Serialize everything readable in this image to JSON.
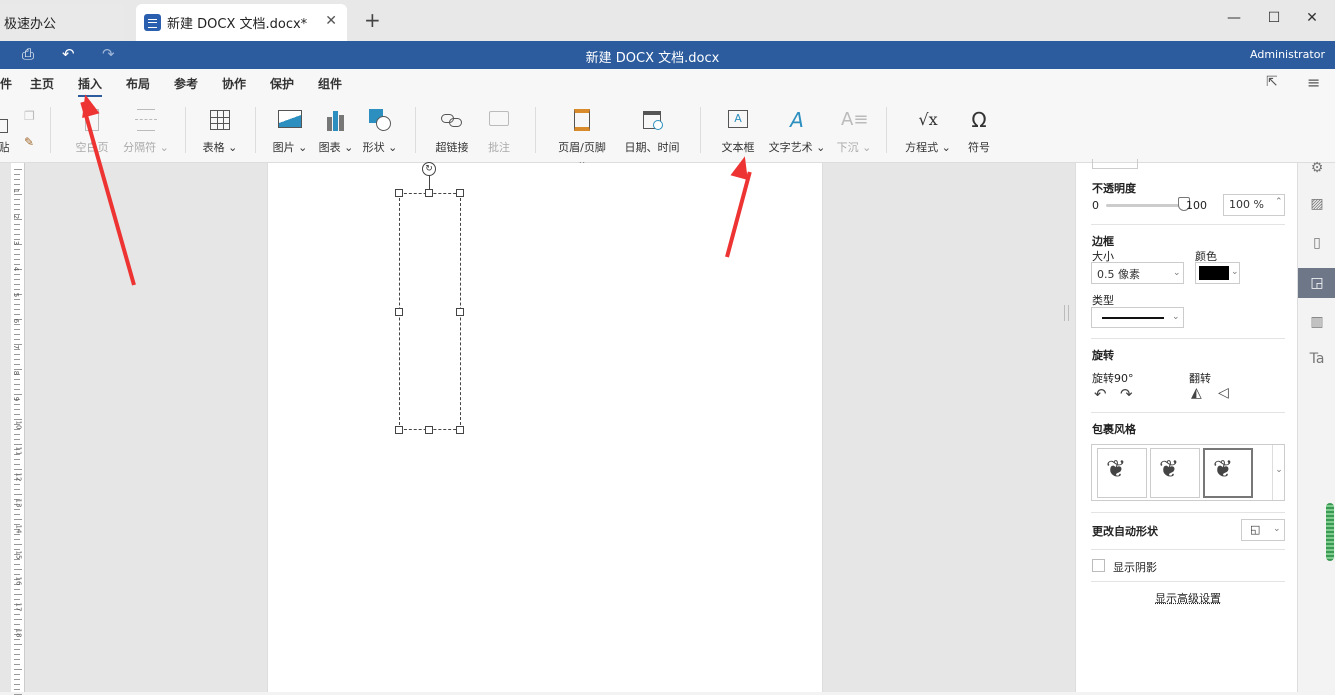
{
  "tabs": {
    "home_tab": "极速办公",
    "doc_tab": "新建 DOCX 文档.docx*",
    "new_tab": "+"
  },
  "window": {
    "minimize": "—",
    "maximize": "☐",
    "close": "✕"
  },
  "titlebar": {
    "title": "新建 DOCX 文档.docx",
    "user": "Administrator"
  },
  "menu": {
    "file_partial": "件",
    "items": [
      "主页",
      "插入",
      "布局",
      "参考",
      "协作",
      "保护",
      "组件"
    ],
    "active": "插入"
  },
  "toolbar": {
    "paste_partial": "贴",
    "blank_page": "空白页",
    "page_break": "分隔符",
    "table": "表格",
    "picture": "图片",
    "chart": "图表",
    "shape": "形状",
    "hyperlink": "超链接",
    "comment": "批注",
    "header_footer": "页眉/页脚",
    "date_time": "日期、时间",
    "textbox": "文本框",
    "wordart": "文字艺术",
    "dropcap": "下沉",
    "equation": "方程式",
    "symbol": "符号"
  },
  "ruler": {
    "numbers": [
      "1",
      "2",
      "3",
      "4",
      "5",
      "6",
      "7",
      "8",
      "9",
      "10",
      "11",
      "12",
      "13",
      "14",
      "15",
      "16",
      "17",
      "18"
    ]
  },
  "panel": {
    "opacity_label": "不透明度",
    "opacity_min": "0",
    "opacity_max": "100",
    "opacity_value": "100 %",
    "opacity_level": 1.0,
    "border_label": "边框",
    "size_label": "大小",
    "size_value": "0.5 像素",
    "color_label": "颜色",
    "border_color": "#000000",
    "type_label": "类型",
    "rotation_label": "旋转",
    "rotate90_label": "旋转90°",
    "flip_label": "翻转",
    "wrap_label": "包裹风格",
    "change_shape_label": "更改自动形状",
    "shadow_label": "显示阴影",
    "advanced_link": "显示高级设置"
  },
  "colors": {
    "brand": "#2c5c9e",
    "arrow": "#ee3333"
  }
}
